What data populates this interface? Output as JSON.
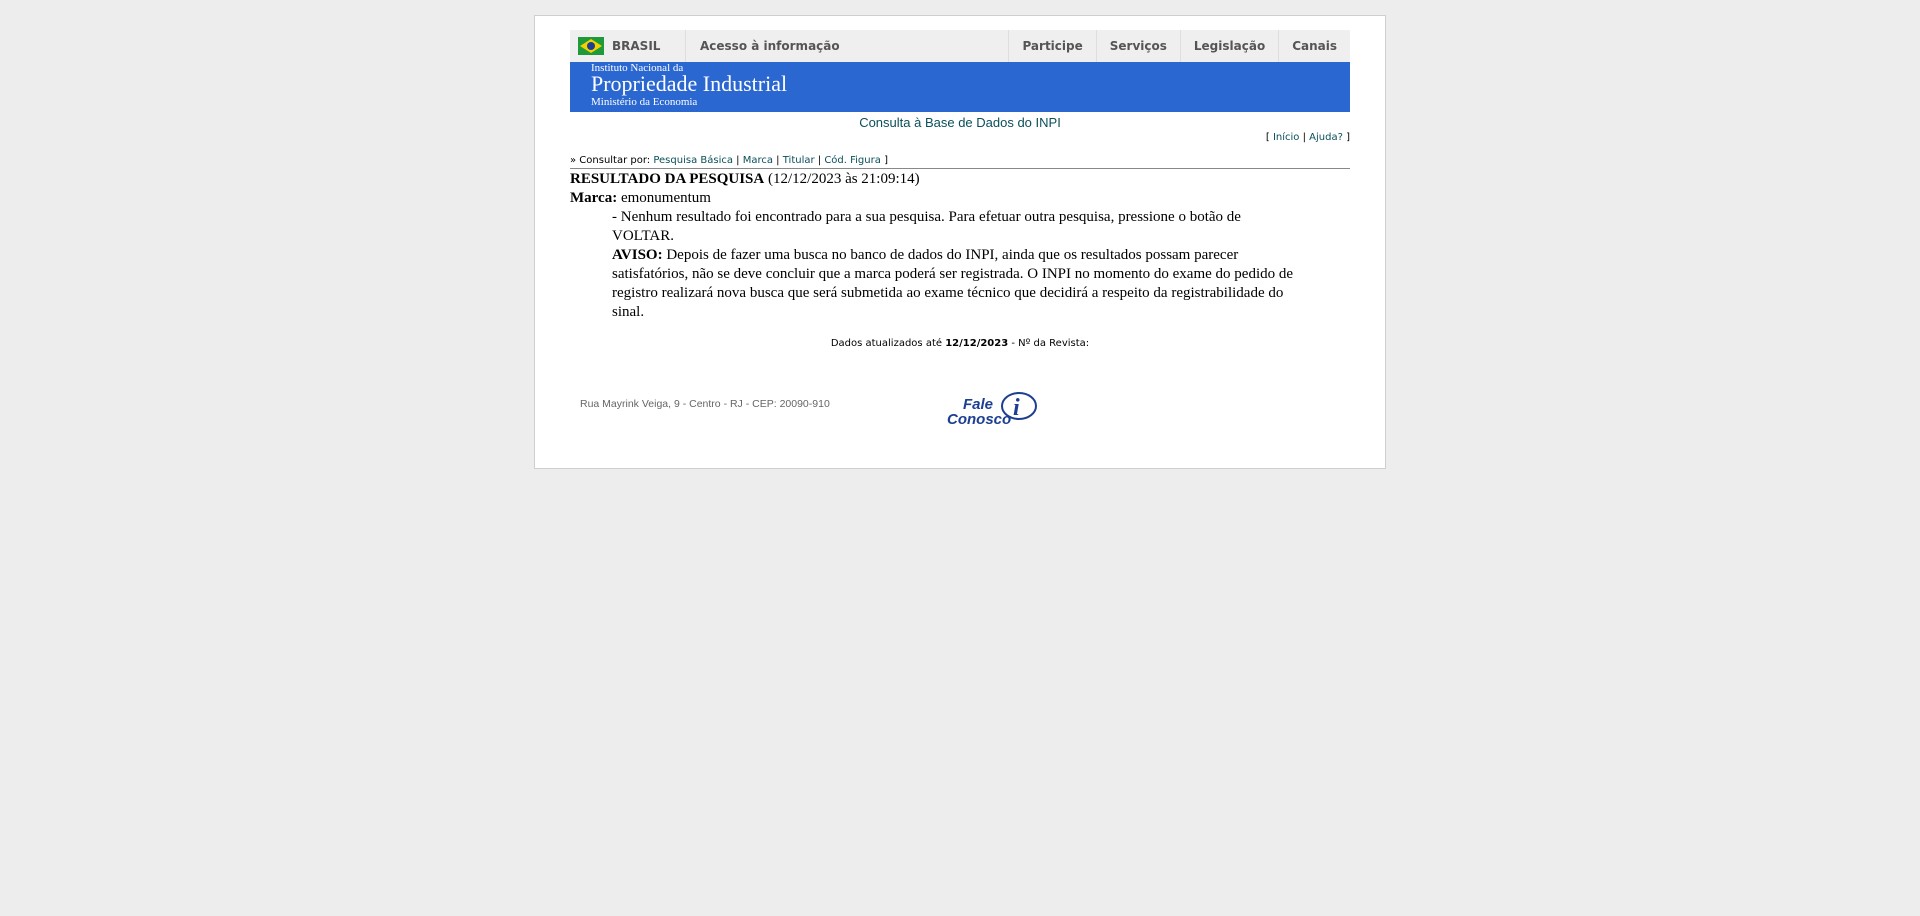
{
  "gov_bar": {
    "country": "BRASIL",
    "acesso": "Acesso à informação",
    "nav": [
      "Participe",
      "Serviços",
      "Legislação",
      "Canais"
    ]
  },
  "banner": {
    "line1": "Instituto Nacional da",
    "line2": "Propriedade Industrial",
    "line3": "Ministério da Economia",
    "color": "#2b67d0"
  },
  "consulta_title": "Consulta à Base de Dados do INPI",
  "top_links": {
    "open": "[",
    "inicio": "Início",
    "sep": "|",
    "ajuda": "Ajuda?",
    "close": "]"
  },
  "consultar": {
    "prefix": "» Consultar por:",
    "links": [
      "Pesquisa Básica",
      "Marca",
      "Titular",
      "Cód. Figura"
    ],
    "close": "]"
  },
  "result": {
    "title": "RESULTADO DA PESQUISA",
    "timestamp": "(12/12/2023 às 21:09:14)",
    "marca_label": "Marca:",
    "marca_value": "emonumentum",
    "message": "- Nenhum resultado foi encontrado para a sua pesquisa. Para efetuar outra pesquisa, pressione o botão de VOLTAR.",
    "aviso_label": "AVISO:",
    "aviso_text": "Depois de fazer uma busca no banco de dados do INPI, ainda que os resultados possam parecer satisfatórios, não se deve concluir que a marca poderá ser registrada. O INPI no momento do exame do pedido de registro realizará nova busca que será submetida ao exame técnico que decidirá a respeito da registrabilidade do sinal."
  },
  "dados": {
    "prefix": "Dados atualizados até",
    "date": "12/12/2023",
    "suffix": "- Nº da Revista:"
  },
  "footer": {
    "address": "Rua Mayrink Veiga, 9 - Centro - RJ - CEP: 20090-910",
    "fale_line1": "Fale",
    "fale_line2": "Conosco",
    "fale_icon_letter": "i"
  }
}
